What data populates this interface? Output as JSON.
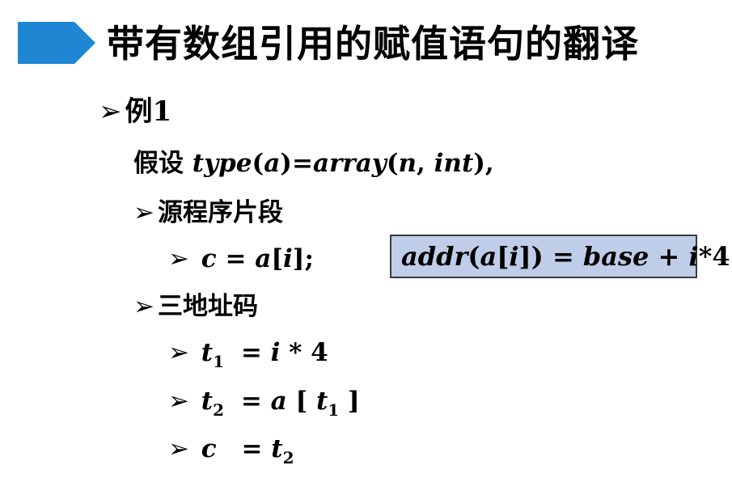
{
  "slide": {
    "title": "带有数组引用的赋值语句的翻译",
    "accent_color": "#1f86d4",
    "bullet_icon": "arrow-bullet-icon"
  },
  "example": {
    "heading": "例1",
    "assumption_prefix": "假设 ",
    "assumption_type": "type",
    "assumption_a": "a",
    "assumption_eq": "=",
    "assumption_array": "array",
    "assumption_n": "n",
    "assumption_int": "int",
    "source_heading": "源程序片段",
    "source_c": "c",
    "source_eq": " = ",
    "source_a": "a",
    "source_i": "i",
    "source_tail": ";",
    "tac_heading": "三地址码",
    "tac": [
      {
        "lhs": "t",
        "lhs_sub": "1",
        "rhs": "= ",
        "rhs_var": "i",
        "rhs_tail": " * 4"
      },
      {
        "lhs": "t",
        "lhs_sub": "2",
        "rhs": "= ",
        "rhs_var": "a",
        "rhs_tail": " [ ",
        "rhs_t": "t",
        "rhs_t_sub": "1",
        "rhs_end": " ]"
      },
      {
        "lhs": "c",
        "rhs": "= ",
        "rhs_t": "t",
        "rhs_t_sub": "2"
      }
    ]
  },
  "address_box": {
    "addr": "addr",
    "a": "a",
    "i": "i",
    "eq": " = ",
    "base": "base",
    "plus": " + ",
    "i2": "i",
    "tail": "*4"
  }
}
